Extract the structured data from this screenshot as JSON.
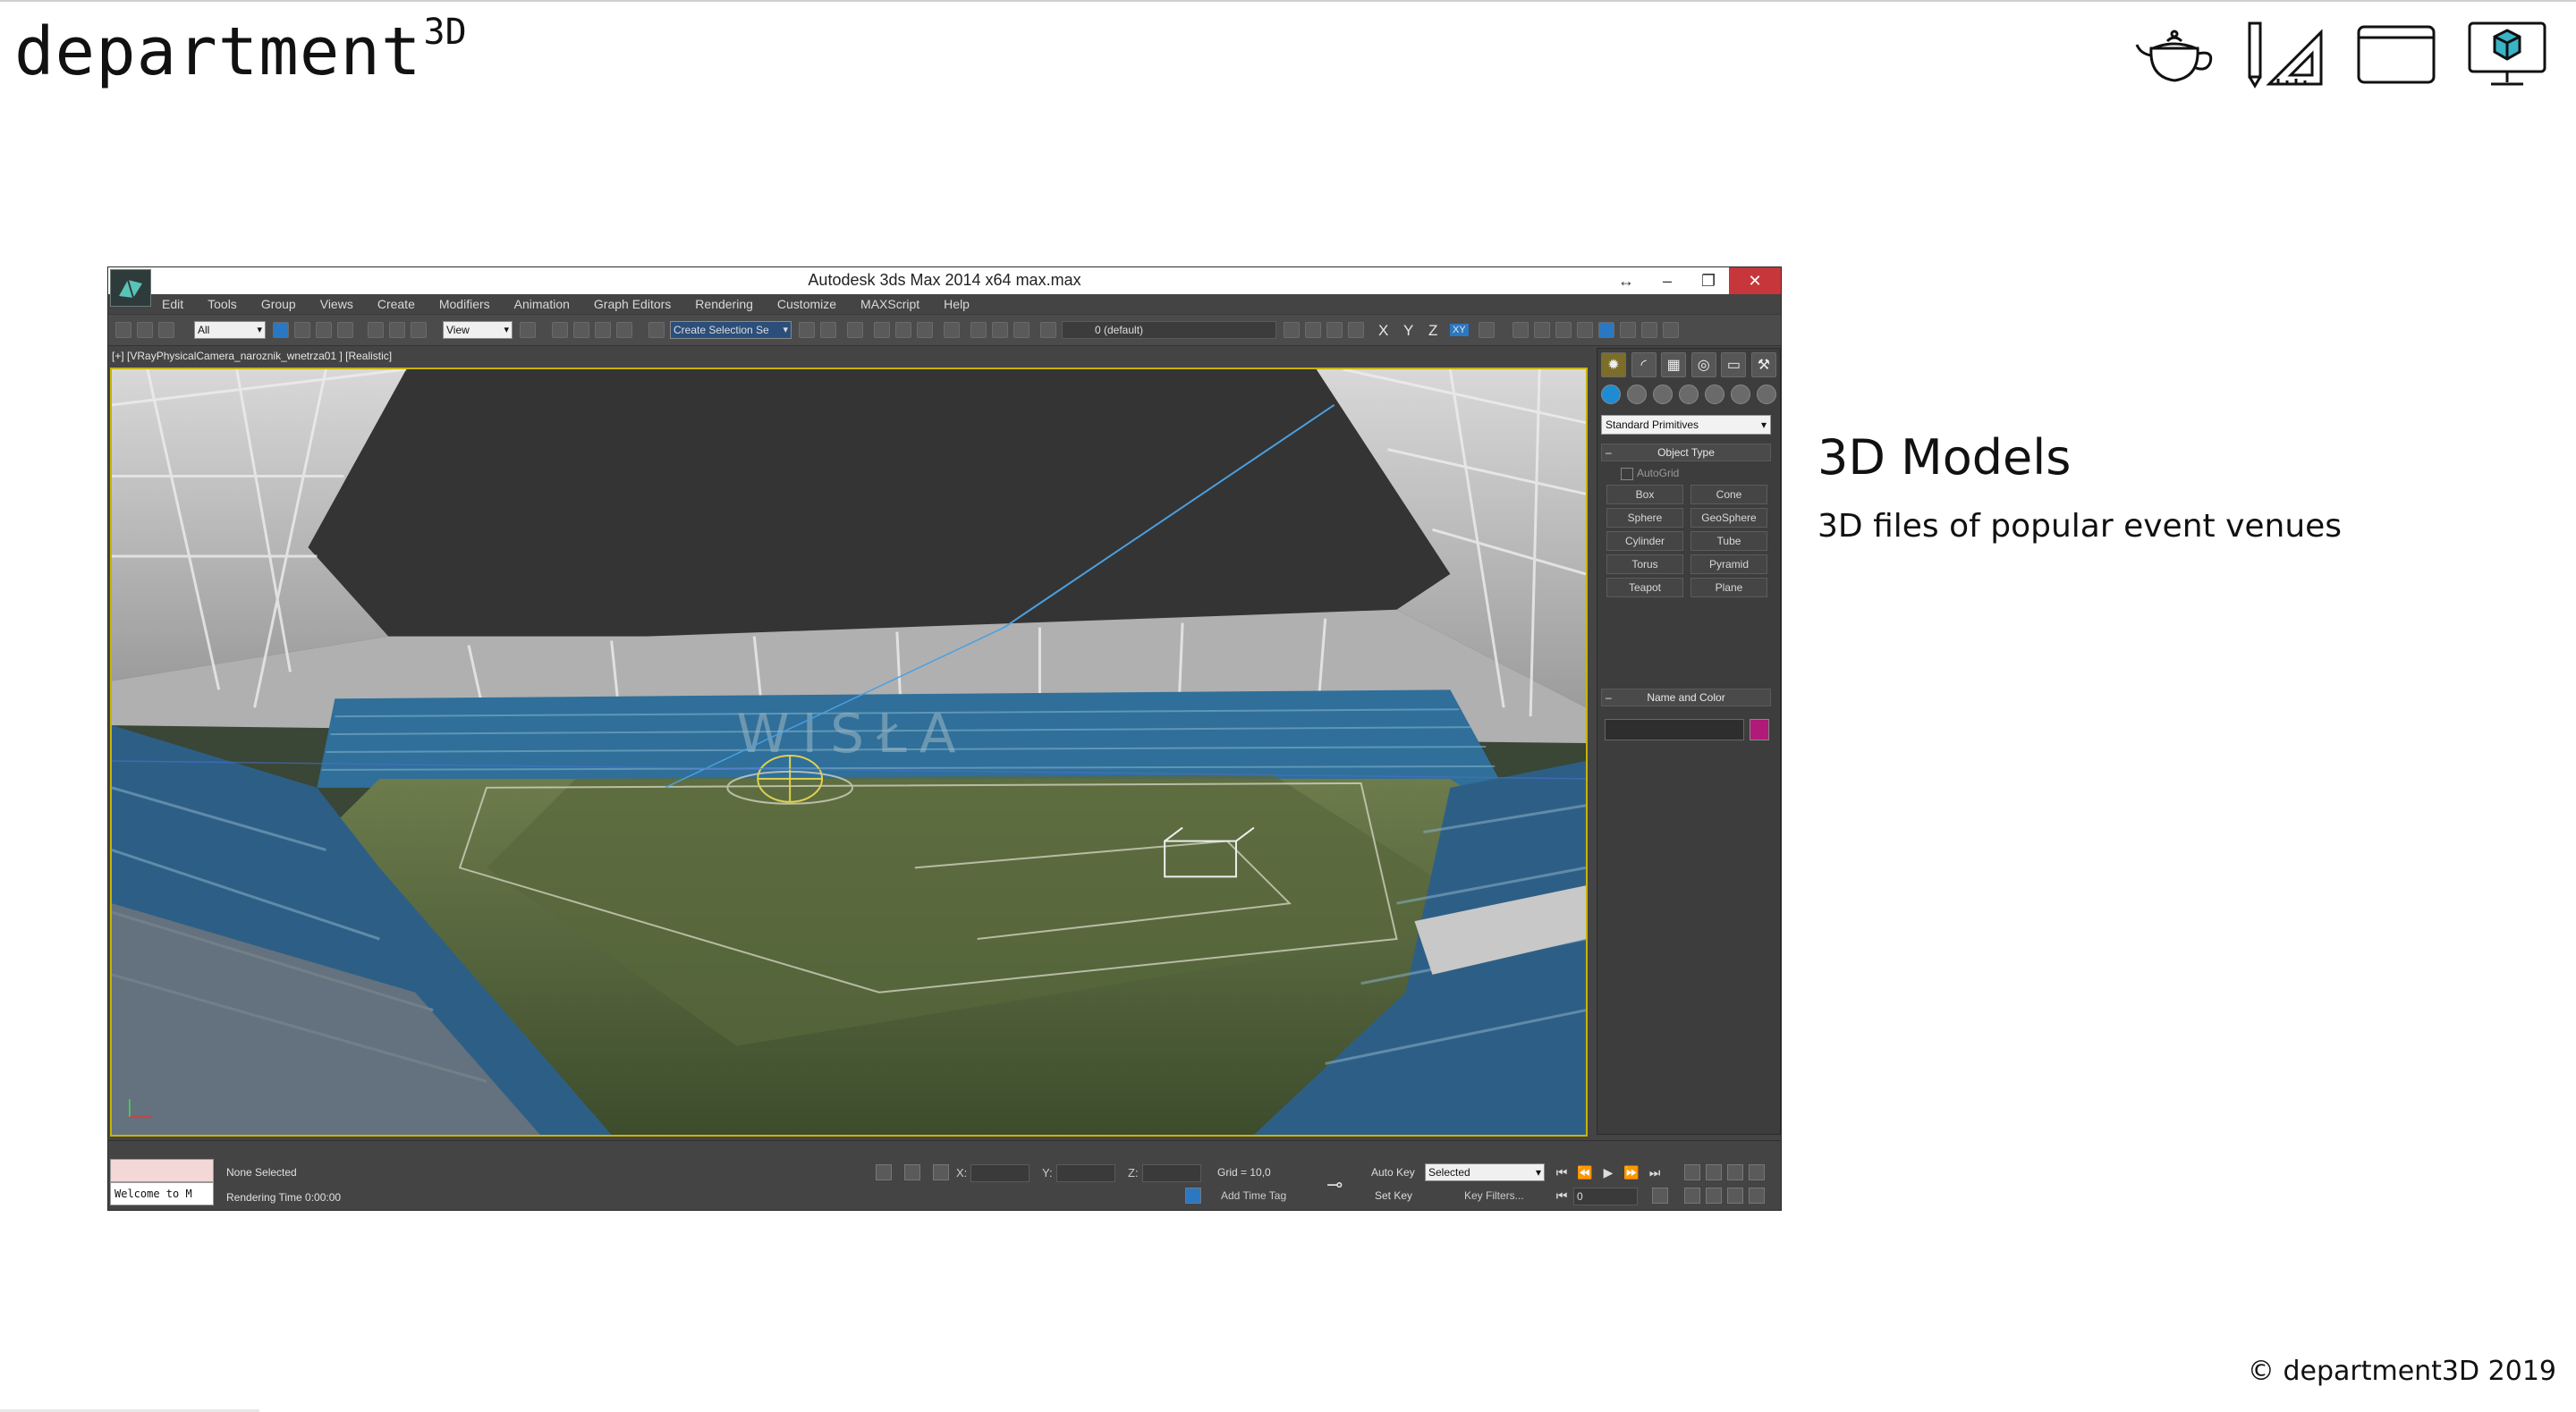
{
  "site": {
    "logo_text": "department",
    "logo_sup": "3D",
    "section_title": "3D Models",
    "section_subtitle": "3D files of popular event venues",
    "copyright": "© department3D 2019"
  },
  "nav_icons": [
    "teapot-icon",
    "drafting-pencil-ruler-icon",
    "browser-window-icon",
    "monitor-cube-icon"
  ],
  "app": {
    "title": "Autodesk 3ds Max  2014 x64     max.max",
    "window_buttons": [
      "↔",
      "–",
      "❐",
      "✕"
    ],
    "menus": [
      "Edit",
      "Tools",
      "Group",
      "Views",
      "Create",
      "Modifiers",
      "Animation",
      "Graph Editors",
      "Rendering",
      "Customize",
      "MAXScript",
      "Help"
    ],
    "toolbar": {
      "filter_select": "All",
      "view_select": "View",
      "selection_set": "Create Selection Se",
      "layer": "0 (default)",
      "axes": [
        "X",
        "Y",
        "Z",
        "XY"
      ]
    },
    "viewport_label": "[+] [VRayPhysicalCamera_naroznik_wnetrza01 ] [Realistic]",
    "command_panel": {
      "category_dropdown": "Standard Primitives",
      "object_type_title": "Object Type",
      "autogrid": "AutoGrid",
      "primitives": [
        "Box",
        "Cone",
        "Sphere",
        "GeoSphere",
        "Cylinder",
        "Tube",
        "Torus",
        "Pyramid",
        "Teapot",
        "Plane"
      ],
      "name_color_title": "Name and Color",
      "swatch_color": "#b01a78"
    },
    "status": {
      "welcome": "Welcome to M",
      "selection": "None Selected",
      "render_time": "Rendering Time  0:00:00",
      "x_label": "X:",
      "y_label": "Y:",
      "z_label": "Z:",
      "grid": "Grid = 10,0",
      "auto_key": "Auto Key",
      "set_key": "Set Key",
      "key_mode": "Selected",
      "key_filters": "Key Filters...",
      "add_time_tag": "Add Time Tag",
      "frame": "0"
    }
  },
  "colors": {
    "accent_close": "#c7363a",
    "viewport_border": "#c8b400",
    "seat_blue": "#2f6f9a",
    "pitch_green": "#4a5e34"
  }
}
